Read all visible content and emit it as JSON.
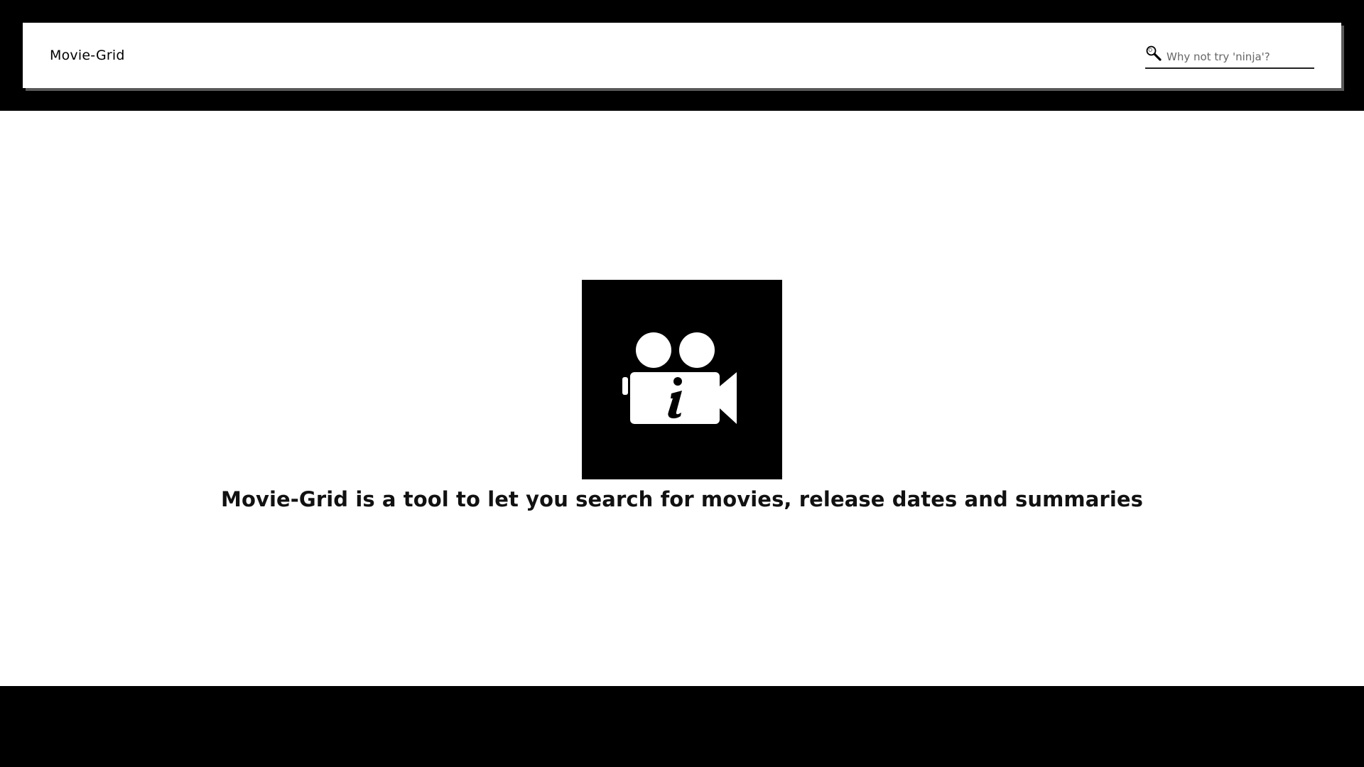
{
  "navbar": {
    "brand": "Movie-Grid",
    "search": {
      "placeholder": "Why not try 'ninja'?",
      "value": "",
      "icon": "search-icon"
    }
  },
  "main": {
    "logo_icon": "movie-camera-info-icon",
    "tagline": "Movie-Grid is a tool to let you search for movies, release dates and summaries"
  },
  "colors": {
    "frame": "#000000",
    "background": "#ffffff",
    "text": "#111111"
  }
}
